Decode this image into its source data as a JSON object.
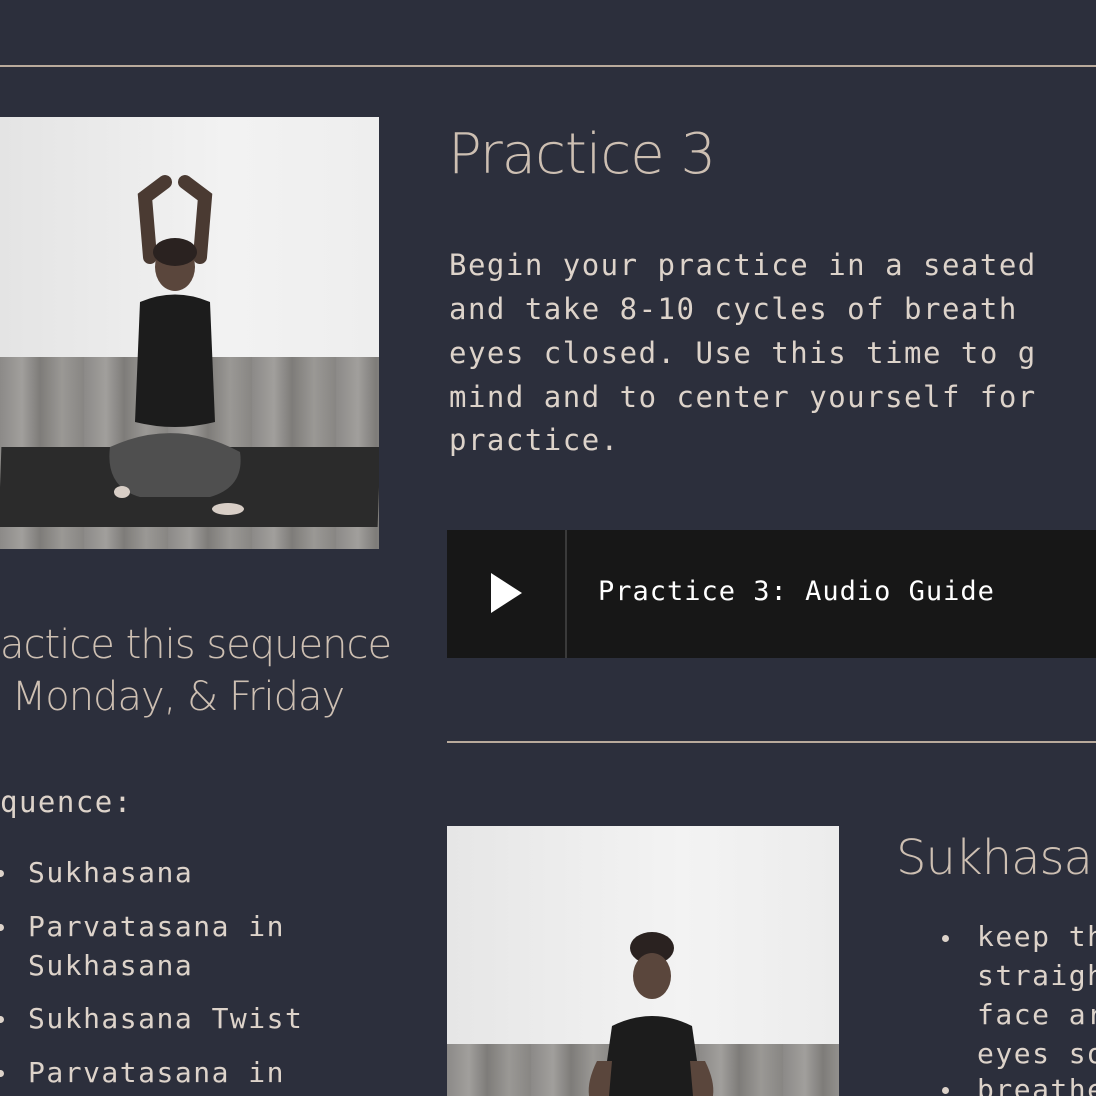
{
  "practice": {
    "title": "Practice 3",
    "description_lines": [
      "Begin your practice in a seated",
      "and take 8-10 cycles of breath",
      "eyes closed. Use this time to g",
      "mind and to center yourself for",
      "practice."
    ]
  },
  "audio": {
    "title": "Practice 3: Audio Guide",
    "play_icon": "play-icon"
  },
  "schedule": {
    "lines": [
      "actice this sequence",
      " Monday, & Friday"
    ]
  },
  "sequence": {
    "heading": "quence:",
    "items": [
      {
        "line1": "Sukhasana",
        "line2": ""
      },
      {
        "line1": "Parvatasana in",
        "line2": "Sukhasana"
      },
      {
        "line1": "Sukhasana Twist",
        "line2": ""
      },
      {
        "line1": "Parvatasana in",
        "line2": ""
      }
    ]
  },
  "pose": {
    "title": "Sukhasar",
    "bullets": [
      [
        "keep th",
        "straigh",
        "face ar",
        "eyes so"
      ],
      [
        "breathe"
      ]
    ]
  },
  "colors": {
    "background": "#2c2f3c",
    "heading": "#cdbfb2",
    "body_text": "#ddd3ca",
    "player": "#171717"
  }
}
